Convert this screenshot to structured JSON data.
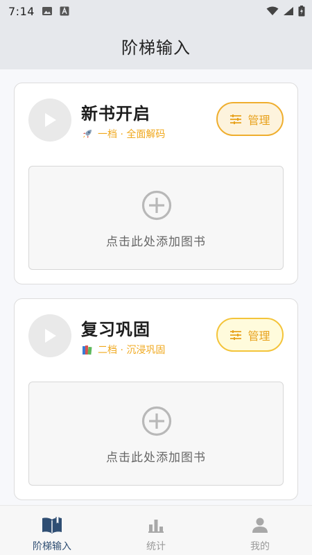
{
  "status_bar": {
    "time": "7:14",
    "left_icons": [
      "image-icon",
      "a-badge-icon"
    ],
    "right_icons": [
      "wifi-icon",
      "signal-icon",
      "battery-icon"
    ]
  },
  "header": {
    "title": "阶梯输入"
  },
  "cards": [
    {
      "title": "新书开启",
      "emoji": "rocket-icon",
      "subtitle": "一档 · 全面解码",
      "manage_label": "管理",
      "add_label": "点击此处添加图书"
    },
    {
      "title": "复习巩固",
      "emoji": "books-icon",
      "subtitle": "二档 · 沉浸巩固",
      "manage_label": "管理",
      "add_label": "点击此处添加图书"
    }
  ],
  "bottom_nav": {
    "items": [
      {
        "label": "阶梯输入",
        "icon": "book-icon",
        "active": true
      },
      {
        "label": "统计",
        "icon": "bar-chart-icon",
        "active": false
      },
      {
        "label": "我的",
        "icon": "person-icon",
        "active": false
      }
    ]
  },
  "colors": {
    "accent": "#f0a81d",
    "nav_active": "#2f4e73",
    "nav_inactive": "#9a9a9a",
    "header_bg": "#e6e8ec"
  }
}
